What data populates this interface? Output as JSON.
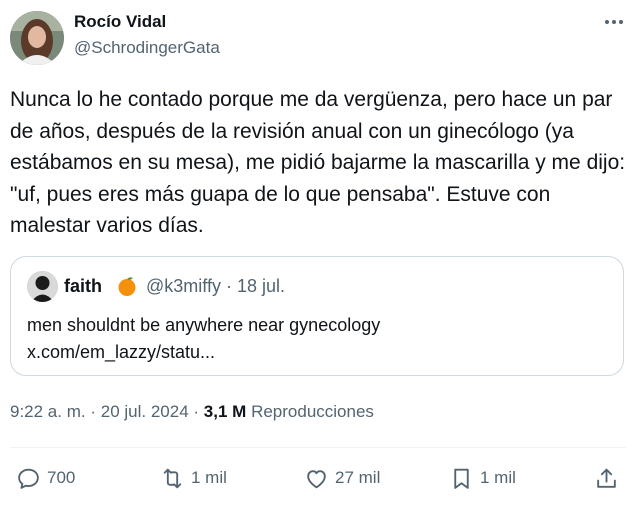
{
  "tweet": {
    "author_name": "Rocío Vidal",
    "author_handle": "@SchrodingerGata",
    "text": "Nunca lo he contado porque me da vergüenza, pero hace un par de años, después de la revisión anual con un ginecólogo (ya estábamos en su mesa), me pidió bajarme la mascarilla y me dijo: \"uf, pues eres más guapa de lo que pensaba\". Estuve con malestar varios días.",
    "more_icon": "more-horizontal-icon"
  },
  "quote": {
    "author_name": "faith",
    "emoji": "🍊",
    "author_handle": "@k3miffy",
    "date": "18 jul.",
    "text_line1": "men shouldnt be anywhere near gynecology",
    "text_line2": "x.com/em_lazzy/statu..."
  },
  "meta": {
    "time": "9:22 a. m.",
    "date": "20 jul. 2024",
    "views": "3,1 M",
    "views_label": "Reproducciones"
  },
  "actions": {
    "replies": "700",
    "retweets": "1 mil",
    "likes": "27 mil",
    "bookmarks": "1 mil"
  },
  "colors": {
    "text": "#0f1419",
    "secondary": "#536471",
    "border": "#cfd9de"
  }
}
